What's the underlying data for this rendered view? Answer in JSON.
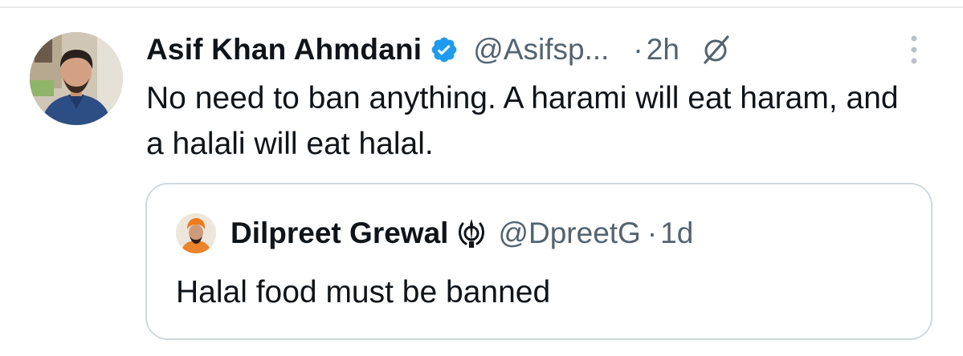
{
  "tweet": {
    "author": {
      "display_name": "Asif Khan Ahmdani",
      "handle": "@Asifsp...",
      "verified_icon": "verified-badge-icon",
      "avatar": "avatar"
    },
    "separator": "·",
    "time": "2h",
    "grok_icon": "grok-icon",
    "more_icon": "more-options-icon",
    "text": "No need to ban anything. A harami will eat haram, and a halali will eat halal.",
    "quoted": {
      "display_name": "Dilpreet Grewal",
      "name_emoji": "khanda-icon",
      "handle": "@DpreetG",
      "separator": "·",
      "time": "1d",
      "text": "Halal food must be banned"
    }
  },
  "colors": {
    "text_primary": "#0f1419",
    "text_secondary": "#536471",
    "verified_blue": "#1d9bf0",
    "border": "#cfd9de"
  }
}
